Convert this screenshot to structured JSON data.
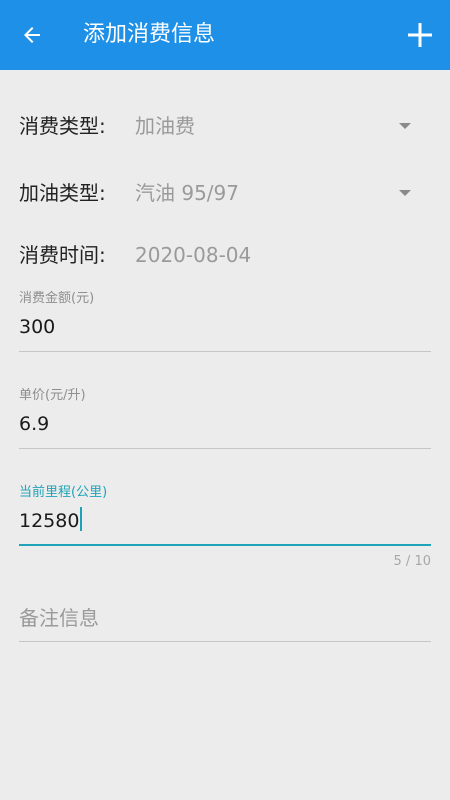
{
  "toolbar": {
    "title": "添加消费信息",
    "back_icon": "arrow-left-icon",
    "add_icon": "plus-icon",
    "background": "#1e90e8"
  },
  "expense_type": {
    "label": "消费类型:",
    "value": "加油费"
  },
  "fuel_type": {
    "label": "加油类型:",
    "value": "汽油 95/97"
  },
  "expense_time": {
    "label": "消费时间:",
    "value": "2020-08-04"
  },
  "amount": {
    "hint": "消费金额(元)",
    "value": "300"
  },
  "unit_price": {
    "hint": "单价(元/升)",
    "value": "6.9"
  },
  "mileage": {
    "hint": "当前里程(公里)",
    "value": "12580",
    "counter": "5 / 10",
    "accent": "#1fa3b8"
  },
  "remark": {
    "placeholder": "备注信息"
  }
}
